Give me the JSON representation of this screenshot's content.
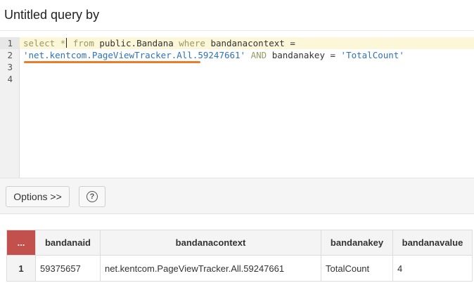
{
  "header": {
    "title": "Untitled query by"
  },
  "editor": {
    "line_numbers": [
      "1",
      "2",
      "3",
      "4"
    ],
    "line1": {
      "t1": "select *",
      "t2": " from",
      "t3": " public.Bandana ",
      "t4": "where",
      "t5": " bandanacontext ="
    },
    "line2": {
      "t1": "'net.kentcom.PageViewTracker.All.59247661'",
      "t2": " AND",
      "t3": " bandanakey = ",
      "t4": "'TotalCount'"
    }
  },
  "toolbar": {
    "options_label": "Options >>",
    "help_label": "?"
  },
  "results": {
    "menu_label": "...",
    "columns": [
      "bandanaid",
      "bandanacontext",
      "bandanakey",
      "bandanavalue"
    ],
    "rows": [
      {
        "num": "1",
        "cells": [
          "59375657",
          "net.kentcom.PageViewTracker.All.59247661",
          "TotalCount",
          "4"
        ]
      }
    ]
  },
  "colors": {
    "menu_header": "#c2514d",
    "string": "#2f72b8",
    "keyword": "#999966",
    "underline": "#e87d2c",
    "active_line": "#fdf7d9"
  }
}
